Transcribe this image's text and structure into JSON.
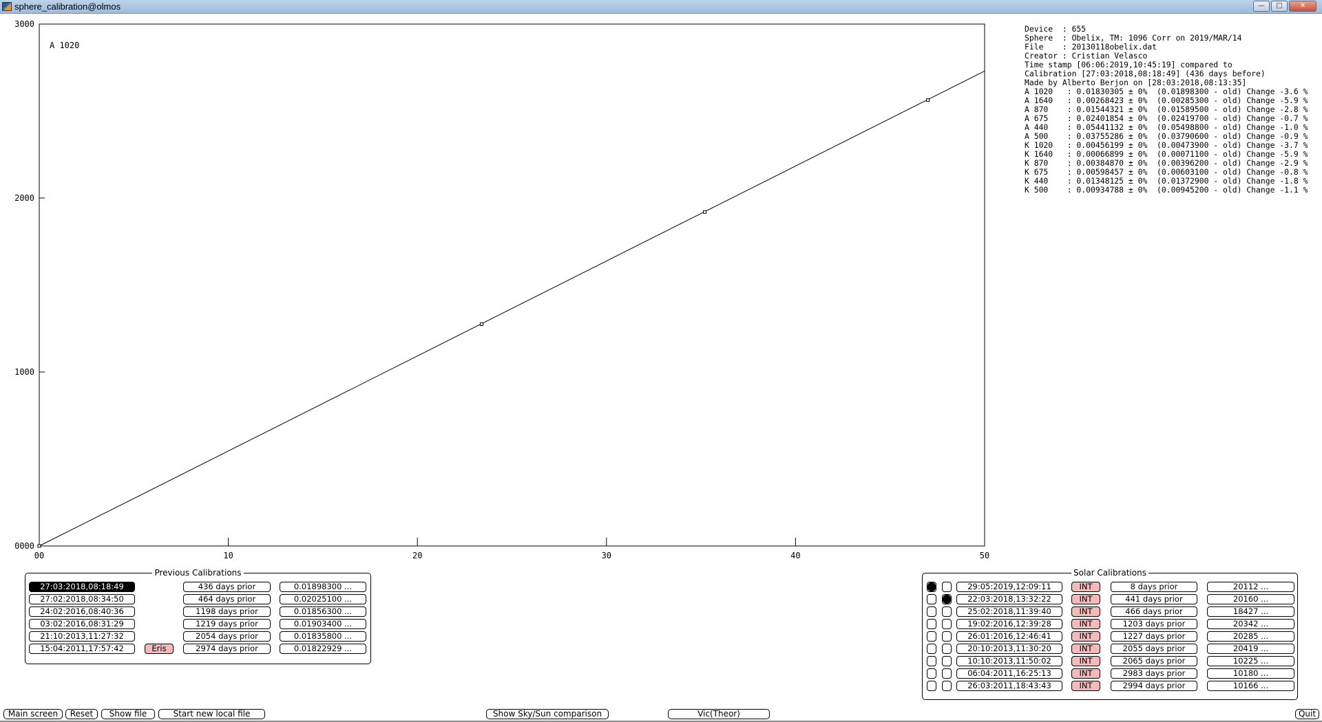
{
  "window": {
    "title": "sphere_calibration@olmos",
    "minimize": "—",
    "maximize": "□",
    "close": "✕"
  },
  "plot": {
    "label": "A 1020",
    "chart_data": {
      "type": "scatter",
      "x_ticks": [
        "00",
        "10",
        "20",
        "30",
        "40",
        "50"
      ],
      "y_ticks": [
        "0000",
        "1000",
        "2000",
        "3000"
      ],
      "xlim": [
        0,
        50
      ],
      "ylim": [
        0,
        3000
      ],
      "points": [
        {
          "x": 0,
          "y": 0
        },
        {
          "x": 23.4,
          "y": 1275
        },
        {
          "x": 35.2,
          "y": 1920
        },
        {
          "x": 47.0,
          "y": 2563
        }
      ],
      "fit_line": {
        "x": [
          0,
          50
        ],
        "y": [
          0,
          2730
        ]
      }
    }
  },
  "info": [
    "Device  : 655",
    "Sphere  : Obelix, TM: 1096 Corr on 2019/MAR/14",
    "File    : 20130118obelix.dat",
    "Creator : Cristian Velasco",
    "Time stamp [06:06:2019,10:45:19] compared to",
    "Calibration [27:03:2018,08:18:49] (436 days before)",
    "Made by Alberto Berjon on [28:03:2018,08:13:35]",
    "A 1020   : 0.01830305 ± 0%  (0.01898300 - old) Change -3.6 %",
    "A 1640   : 0.00268423 ± 0%  (0.00285300 - old) Change -5.9 %",
    "A 870    : 0.01544321 ± 0%  (0.01589500 - old) Change -2.8 %",
    "A 675    : 0.02401854 ± 0%  (0.02419700 - old) Change -0.7 %",
    "A 440    : 0.05441132 ± 0%  (0.05498800 - old) Change -1.0 %",
    "A 500    : 0.03755286 ± 0%  (0.03790600 - old) Change -0.9 %",
    "K 1020   : 0.00456199 ± 0%  (0.00473900 - old) Change -3.7 %",
    "K 1640   : 0.00066899 ± 0%  (0.00071100 - old) Change -5.9 %",
    "K 870    : 0.00384870 ± 0%  (0.00396200 - old) Change -2.9 %",
    "K 675    : 0.00598457 ± 0%  (0.00603100 - old) Change -0.8 %",
    "K 440    : 0.01348125 ± 0%  (0.01372900 - old) Change -1.8 %",
    "K 500    : 0.00934788 ± 0%  (0.00945200 - old) Change -1.1 %"
  ],
  "previous": {
    "title": "Previous Calibrations",
    "rows": [
      {
        "date": "27:03:2018,08:18:49",
        "tag": "",
        "prior": "436 days prior",
        "value": "0.01898300 ...",
        "selected": true
      },
      {
        "date": "27:02:2018,08:34:50",
        "tag": "",
        "prior": "464 days prior",
        "value": "0.02025100 ...",
        "selected": false
      },
      {
        "date": "24:02:2016,08:40:36",
        "tag": "",
        "prior": "1198 days prior",
        "value": "0.01856300 ...",
        "selected": false
      },
      {
        "date": "03:02:2016,08:31:29",
        "tag": "",
        "prior": "1219 days prior",
        "value": "0.01903400 ...",
        "selected": false
      },
      {
        "date": "21:10:2013,11:27:32",
        "tag": "",
        "prior": "2054 days prior",
        "value": "0.01835800 ...",
        "selected": false
      },
      {
        "date": "15:04:2011,17:57:42",
        "tag": "Eris",
        "prior": "2974 days prior",
        "value": "0.01822929 ...",
        "selected": false
      }
    ]
  },
  "solar": {
    "title": "Solar Calibrations",
    "rows": [
      {
        "r1": true,
        "r2": false,
        "date": "29:05:2019,12:09:11",
        "type": "INT",
        "prior": "8 days prior",
        "value": "20112 ..."
      },
      {
        "r1": false,
        "r2": true,
        "date": "22:03:2018,13:32:22",
        "type": "INT",
        "prior": "441 days prior",
        "value": "20160 ..."
      },
      {
        "r1": false,
        "r2": false,
        "date": "25:02:2018,11:39:40",
        "type": "INT",
        "prior": "466 days prior",
        "value": "18427 ..."
      },
      {
        "r1": false,
        "r2": false,
        "date": "19:02:2016,12:39:28",
        "type": "INT",
        "prior": "1203 days prior",
        "value": "20342 ..."
      },
      {
        "r1": false,
        "r2": false,
        "date": "26:01:2016,12:46:41",
        "type": "INT",
        "prior": "1227 days prior",
        "value": "20285 ..."
      },
      {
        "r1": false,
        "r2": false,
        "date": "20:10:2013,11:30:20",
        "type": "INT",
        "prior": "2055 days prior",
        "value": "20419 ..."
      },
      {
        "r1": false,
        "r2": false,
        "date": "10:10:2013,11:50:02",
        "type": "INT",
        "prior": "2065 days prior",
        "value": "10225 ..."
      },
      {
        "r1": false,
        "r2": false,
        "date": "06:04:2011,16:25:13",
        "type": "INT",
        "prior": "2983 days prior",
        "value": "10180 ..."
      },
      {
        "r1": false,
        "r2": false,
        "date": "26:03:2011,18:43:43",
        "type": "INT",
        "prior": "2994 days prior",
        "value": "10166 ..."
      }
    ]
  },
  "buttons": {
    "main_screen": "Main screen",
    "reset": "Reset",
    "show_file": "Show file",
    "start_new": "Start new local file",
    "sky_sun": "Show Sky/Sun comparison",
    "vic": "Vic(Theor)",
    "quit": "Quit"
  }
}
